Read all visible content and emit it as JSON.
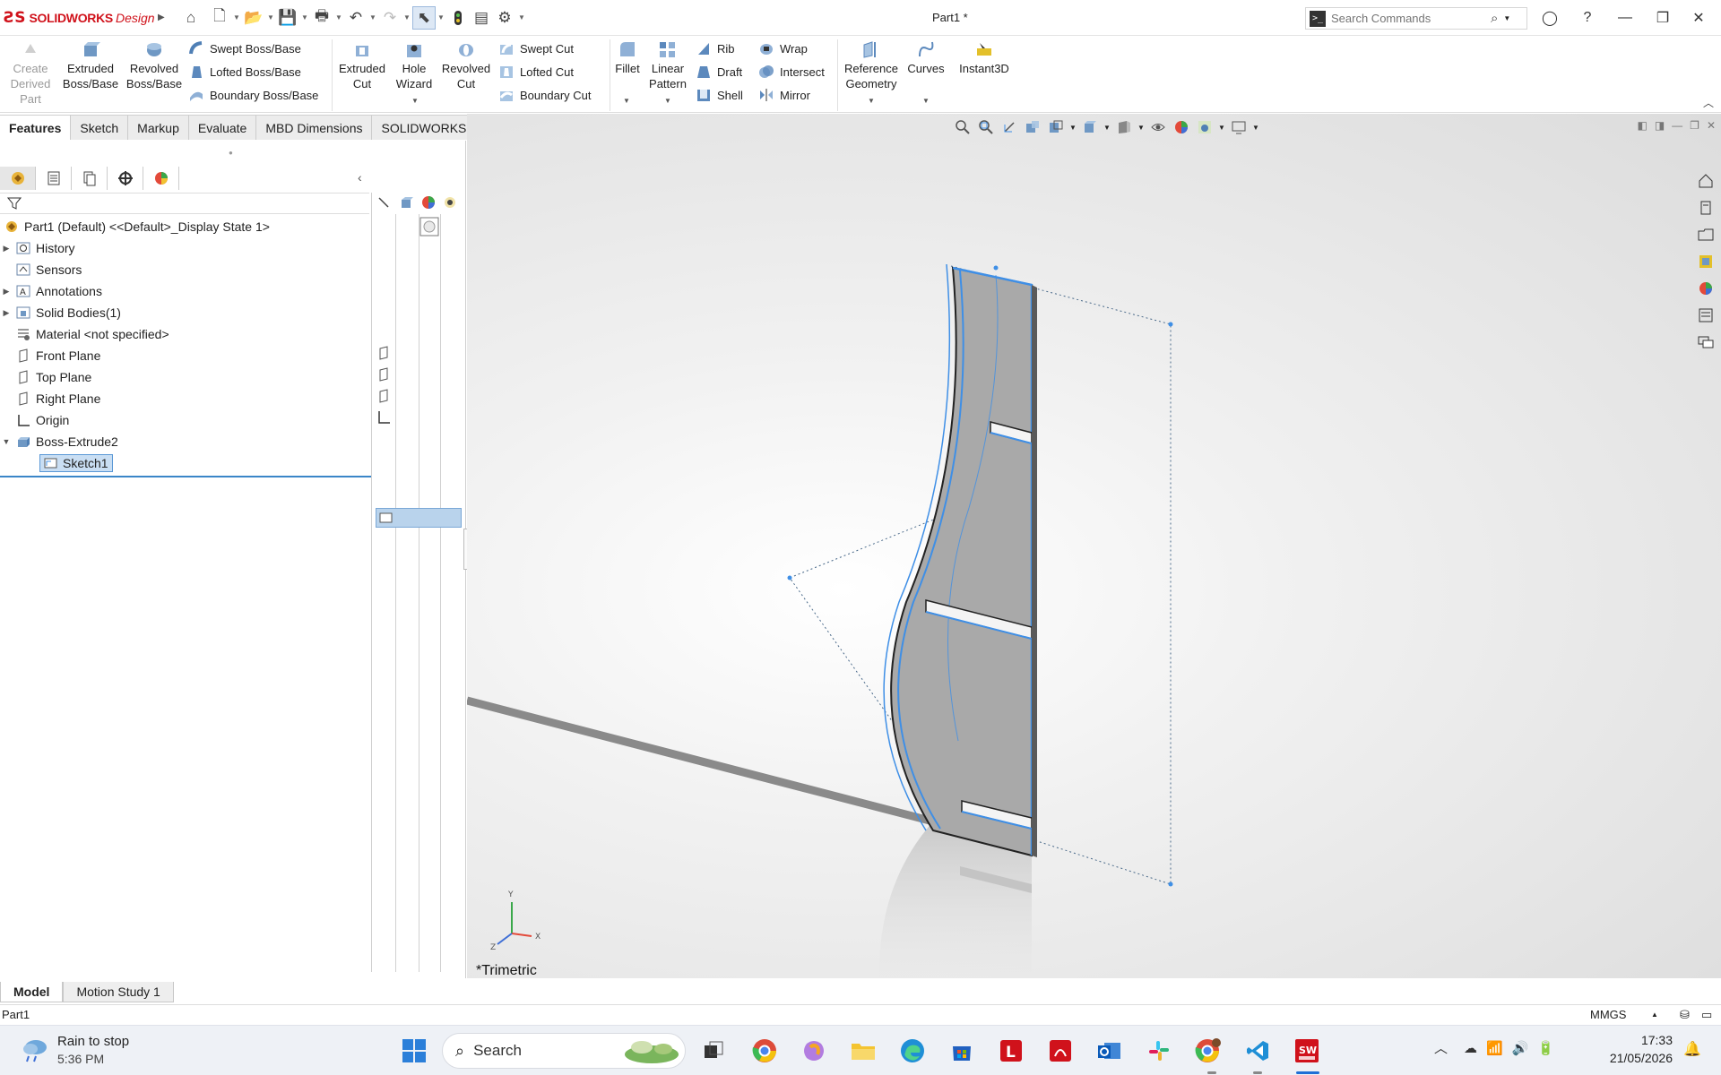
{
  "app": {
    "brand": "SOLIDWORKS",
    "brand_suffix": "Design",
    "doc_title": "Part1 *",
    "search_placeholder": "Search Commands"
  },
  "ribbon": {
    "create_derived": [
      "Create",
      "Derived",
      "Part"
    ],
    "extruded_boss": [
      "Extruded",
      "Boss/Base"
    ],
    "revolved_boss": [
      "Revolved",
      "Boss/Base"
    ],
    "swept_boss": "Swept Boss/Base",
    "lofted_boss": "Lofted Boss/Base",
    "boundary_boss": "Boundary Boss/Base",
    "extruded_cut": [
      "Extruded",
      "Cut"
    ],
    "hole_wizard": [
      "Hole",
      "Wizard"
    ],
    "revolved_cut": [
      "Revolved",
      "Cut"
    ],
    "swept_cut": "Swept Cut",
    "lofted_cut": "Lofted Cut",
    "boundary_cut": "Boundary Cut",
    "fillet": "Fillet",
    "linear_pattern": [
      "Linear",
      "Pattern"
    ],
    "rib": "Rib",
    "draft": "Draft",
    "shell": "Shell",
    "wrap": "Wrap",
    "intersect": "Intersect",
    "mirror": "Mirror",
    "reference_geometry": [
      "Reference",
      "Geometry"
    ],
    "curves": "Curves",
    "instant3d": "Instant3D"
  },
  "tabs": [
    "Features",
    "Sketch",
    "Markup",
    "Evaluate",
    "MBD Dimensions",
    "SOLIDWORKS Add-Ins"
  ],
  "tree": {
    "root": "Part1 (Default) <<Default>_Display State 1>",
    "items": [
      {
        "label": "History",
        "expandable": true
      },
      {
        "label": "Sensors",
        "expandable": false
      },
      {
        "label": "Annotations",
        "expandable": true
      },
      {
        "label": "Solid Bodies(1)",
        "expandable": true
      },
      {
        "label": "Material <not specified>",
        "expandable": false
      },
      {
        "label": "Front Plane",
        "expandable": false
      },
      {
        "label": "Top Plane",
        "expandable": false
      },
      {
        "label": "Right Plane",
        "expandable": false
      },
      {
        "label": "Origin",
        "expandable": false
      },
      {
        "label": "Boss-Extrude2",
        "expandable": true,
        "expanded": true
      },
      {
        "label": "Sketch1",
        "child": true,
        "selected": true
      }
    ]
  },
  "viewport": {
    "view_label": "*Trimetric",
    "triad": {
      "x": "X",
      "y": "Y",
      "z": "Z"
    }
  },
  "model_tabs": [
    "Model",
    "Motion Study 1"
  ],
  "status": {
    "left": "Part1",
    "units": "MMGS"
  },
  "taskbar": {
    "weather_line1": "Rain to stop",
    "weather_line2": "5:36 PM",
    "search": "Search",
    "time": "17:33",
    "date": "21/05/2026"
  },
  "colors": {
    "brand_red": "#d0121b",
    "selection_blue": "#3f8fe6",
    "part_gray": "#a8a8a8"
  }
}
